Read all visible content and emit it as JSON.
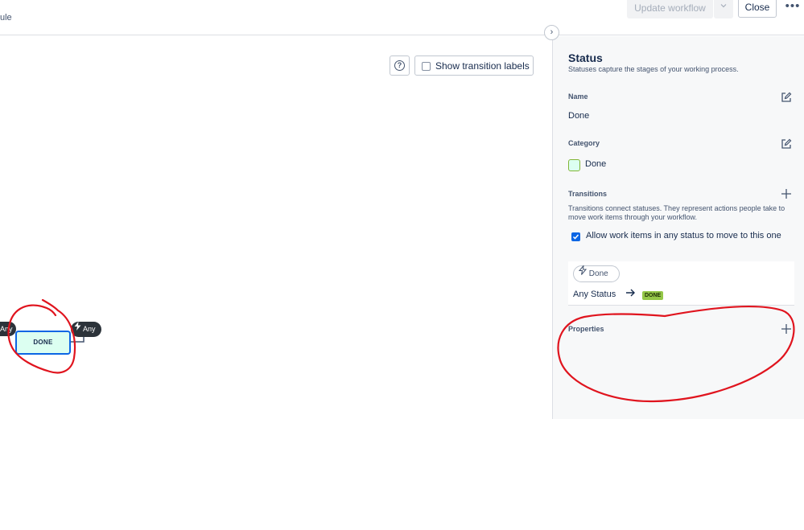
{
  "header": {
    "breadcrumb": "ule",
    "update_button": "Update workflow",
    "close_button": "Close",
    "more_glyph": "•••"
  },
  "canvas": {
    "help_glyph": "?",
    "show_labels": "Show transition labels",
    "collapse_glyph": "›",
    "left_pill": "Any",
    "node_label": "DONE",
    "right_pill": "Any",
    "node_color": "#dcfff1",
    "node_border_color": "#0c66e4"
  },
  "panel": {
    "title": "Status",
    "subtitle": "Statuses capture the stages of your working process.",
    "name_label": "Name",
    "name_value": "Done",
    "category_label": "Category",
    "category_value": "Done",
    "category_color": "#94c748",
    "transitions_label": "Transitions",
    "transitions_desc": "Transitions connect statuses. They represent actions people take to move work items through your workflow.",
    "allow_any_label": "Allow work items in any status to move to this one",
    "allow_any_checked": true,
    "transition": {
      "name": "Done",
      "from": "Any Status",
      "to": "DONE"
    },
    "properties_label": "Properties"
  },
  "icons": [
    "chevron-down-icon",
    "more-icon",
    "help-icon",
    "chevron-right-icon",
    "lightning-icon",
    "edit-icon",
    "plus-icon",
    "arrow-right-icon",
    "check-icon"
  ],
  "annotation_color": "#e0141e"
}
